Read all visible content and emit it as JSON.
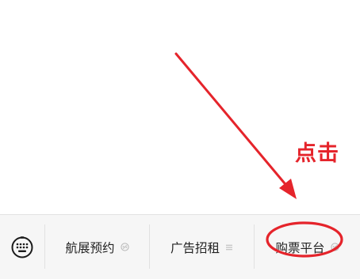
{
  "annotation": {
    "tap_label": "点击",
    "accent_color": "#e5242b"
  },
  "menu_bar": {
    "keyboard_icon": "keyboard-icon",
    "items": [
      {
        "label": "航展预约",
        "icon": "link-icon"
      },
      {
        "label": "广告招租",
        "icon": "submenu-lines-icon"
      },
      {
        "label": "购票平台",
        "icon": "link-icon"
      }
    ]
  }
}
